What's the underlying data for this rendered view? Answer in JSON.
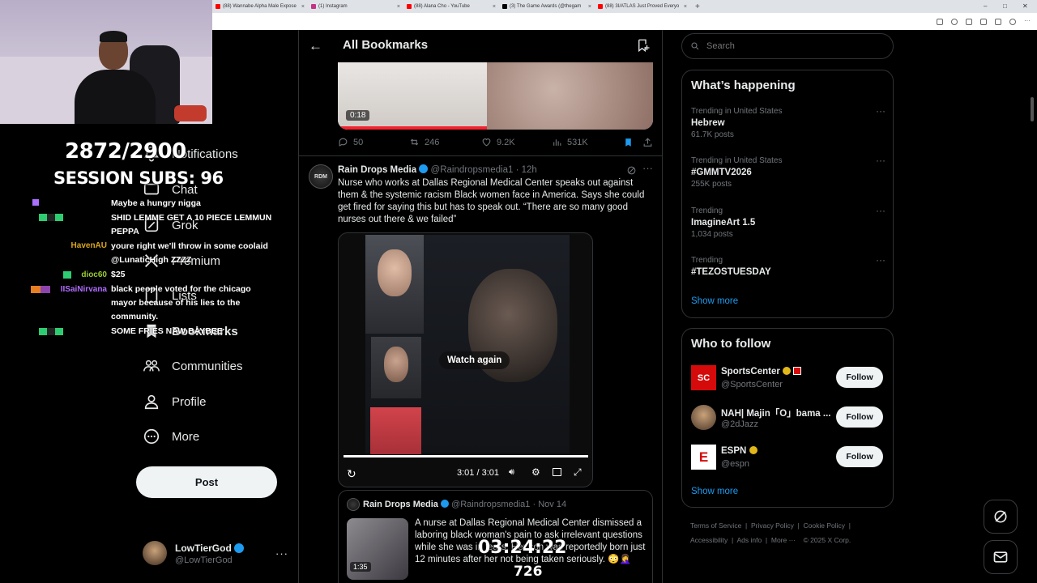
{
  "browser": {
    "tabs": [
      {
        "title": "(88) Wannabe Alpha Male Expose",
        "color": "#ff0000"
      },
      {
        "title": "(1) Instagram",
        "color": "#c13584"
      },
      {
        "title": "(88) Alana Cho - YouTube",
        "color": "#ff0000"
      },
      {
        "title": "(3) The Game Awards (@thegam",
        "color": "#000000"
      },
      {
        "title": "(88) 3I/ATLAS Just Proved Everyo",
        "color": "#ff0000"
      }
    ]
  },
  "stream_overlay": {
    "sub_goal": "2872/2900",
    "session_subs": "SESSION SUBS: 96",
    "timer": "03:24:22",
    "counter": "726",
    "chat": [
      {
        "user": "",
        "message": "Maybe a hungry nigga",
        "color": "#a970ff"
      },
      {
        "user": "",
        "message": "SHID LEMME GET A 10 PIECE LEMMUN PEPPA",
        "color": "#8a2be2"
      },
      {
        "user": "HavenAU",
        "message": "youre right we'll throw in some coolaid @LunaticHigh ZZZZ",
        "color": "#daa520"
      },
      {
        "user": "dioc60",
        "message": "$25",
        "color": "#9acd32"
      },
      {
        "user": "IISaiNirvana",
        "message": "black people voted for the chicago mayor because of his lies to the community.",
        "color": "#8a2be2"
      },
      {
        "user": "",
        "message": "SOME FRIES NAW BAYBEE",
        "color": "#8a2be2"
      }
    ]
  },
  "nav": {
    "notifications": "Notifications",
    "chat": "Chat",
    "grok": "Grok",
    "premium": "Premium",
    "lists": "Lists",
    "bookmarks": "Bookmarks",
    "communities": "Communities",
    "profile": "Profile",
    "more": "More",
    "post": "Post",
    "account": {
      "name": "LowTierGod",
      "handle": "@LowTierGod"
    }
  },
  "header": {
    "title": "All Bookmarks"
  },
  "tweet1": {
    "video_time": "0:18",
    "replies": "50",
    "retweets": "246",
    "likes": "9.2K",
    "views": "531K"
  },
  "tweet2": {
    "name": "Rain Drops Media",
    "handle": "@Raindropsmedia1",
    "time": "12h",
    "text": "Nurse who works at Dallas Regional Medical Center speaks out against them & the systemic racism Black women face in America. Says she could get fired for saying this but has to speak out. “There are so many good nurses out there & we failed”",
    "watch_again": "Watch again",
    "video_time": "3:01 / 3:01",
    "quote": {
      "name": "Rain Drops Media",
      "handle": "@Raindropsmedia1",
      "time": "Nov 14",
      "video_time": "1:35",
      "text": "A nurse at Dallas Regional Medical Center dismissed a laboring  black woman's pain to ask irrelevant questions while she was in tears. Her son was reportedly born just 12 minutes after her not being taken seriously. 😳🤦‍♀️"
    }
  },
  "search": {
    "placeholder": "Search"
  },
  "trends": {
    "title": "What’s happening",
    "items": [
      {
        "meta": "Trending in United States",
        "name": "Hebrew",
        "count": "61.7K posts"
      },
      {
        "meta": "Trending in United States",
        "name": "#GMMTV2026",
        "count": "255K posts"
      },
      {
        "meta": "Trending",
        "name": "ImagineArt 1.5",
        "count": "1,034 posts"
      },
      {
        "meta": "Trending",
        "name": "#TEZOSTUESDAY",
        "count": ""
      }
    ],
    "show_more": "Show more"
  },
  "who_to_follow": {
    "title": "Who to follow",
    "items": [
      {
        "name": "SportsCenter",
        "handle": "@SportsCenter",
        "follow": "Follow",
        "avatar_color": "#d50a0a",
        "avatar_text": "SC"
      },
      {
        "name": "NAH| Majin「O」bama ...",
        "handle": "@2dJazz",
        "follow": "Follow",
        "avatar_color": "#6b5a4e",
        "avatar_text": ""
      },
      {
        "name": "ESPN",
        "handle": "@espn",
        "follow": "Follow",
        "avatar_color": "#ffffff",
        "avatar_text": "E"
      }
    ],
    "show_more": "Show more"
  },
  "footer": {
    "line1": [
      "Terms of Service",
      "Privacy Policy",
      "Cookie Policy"
    ],
    "line2": [
      "Accessibility",
      "Ads info",
      "More ···",
      "© 2025 X Corp."
    ]
  }
}
